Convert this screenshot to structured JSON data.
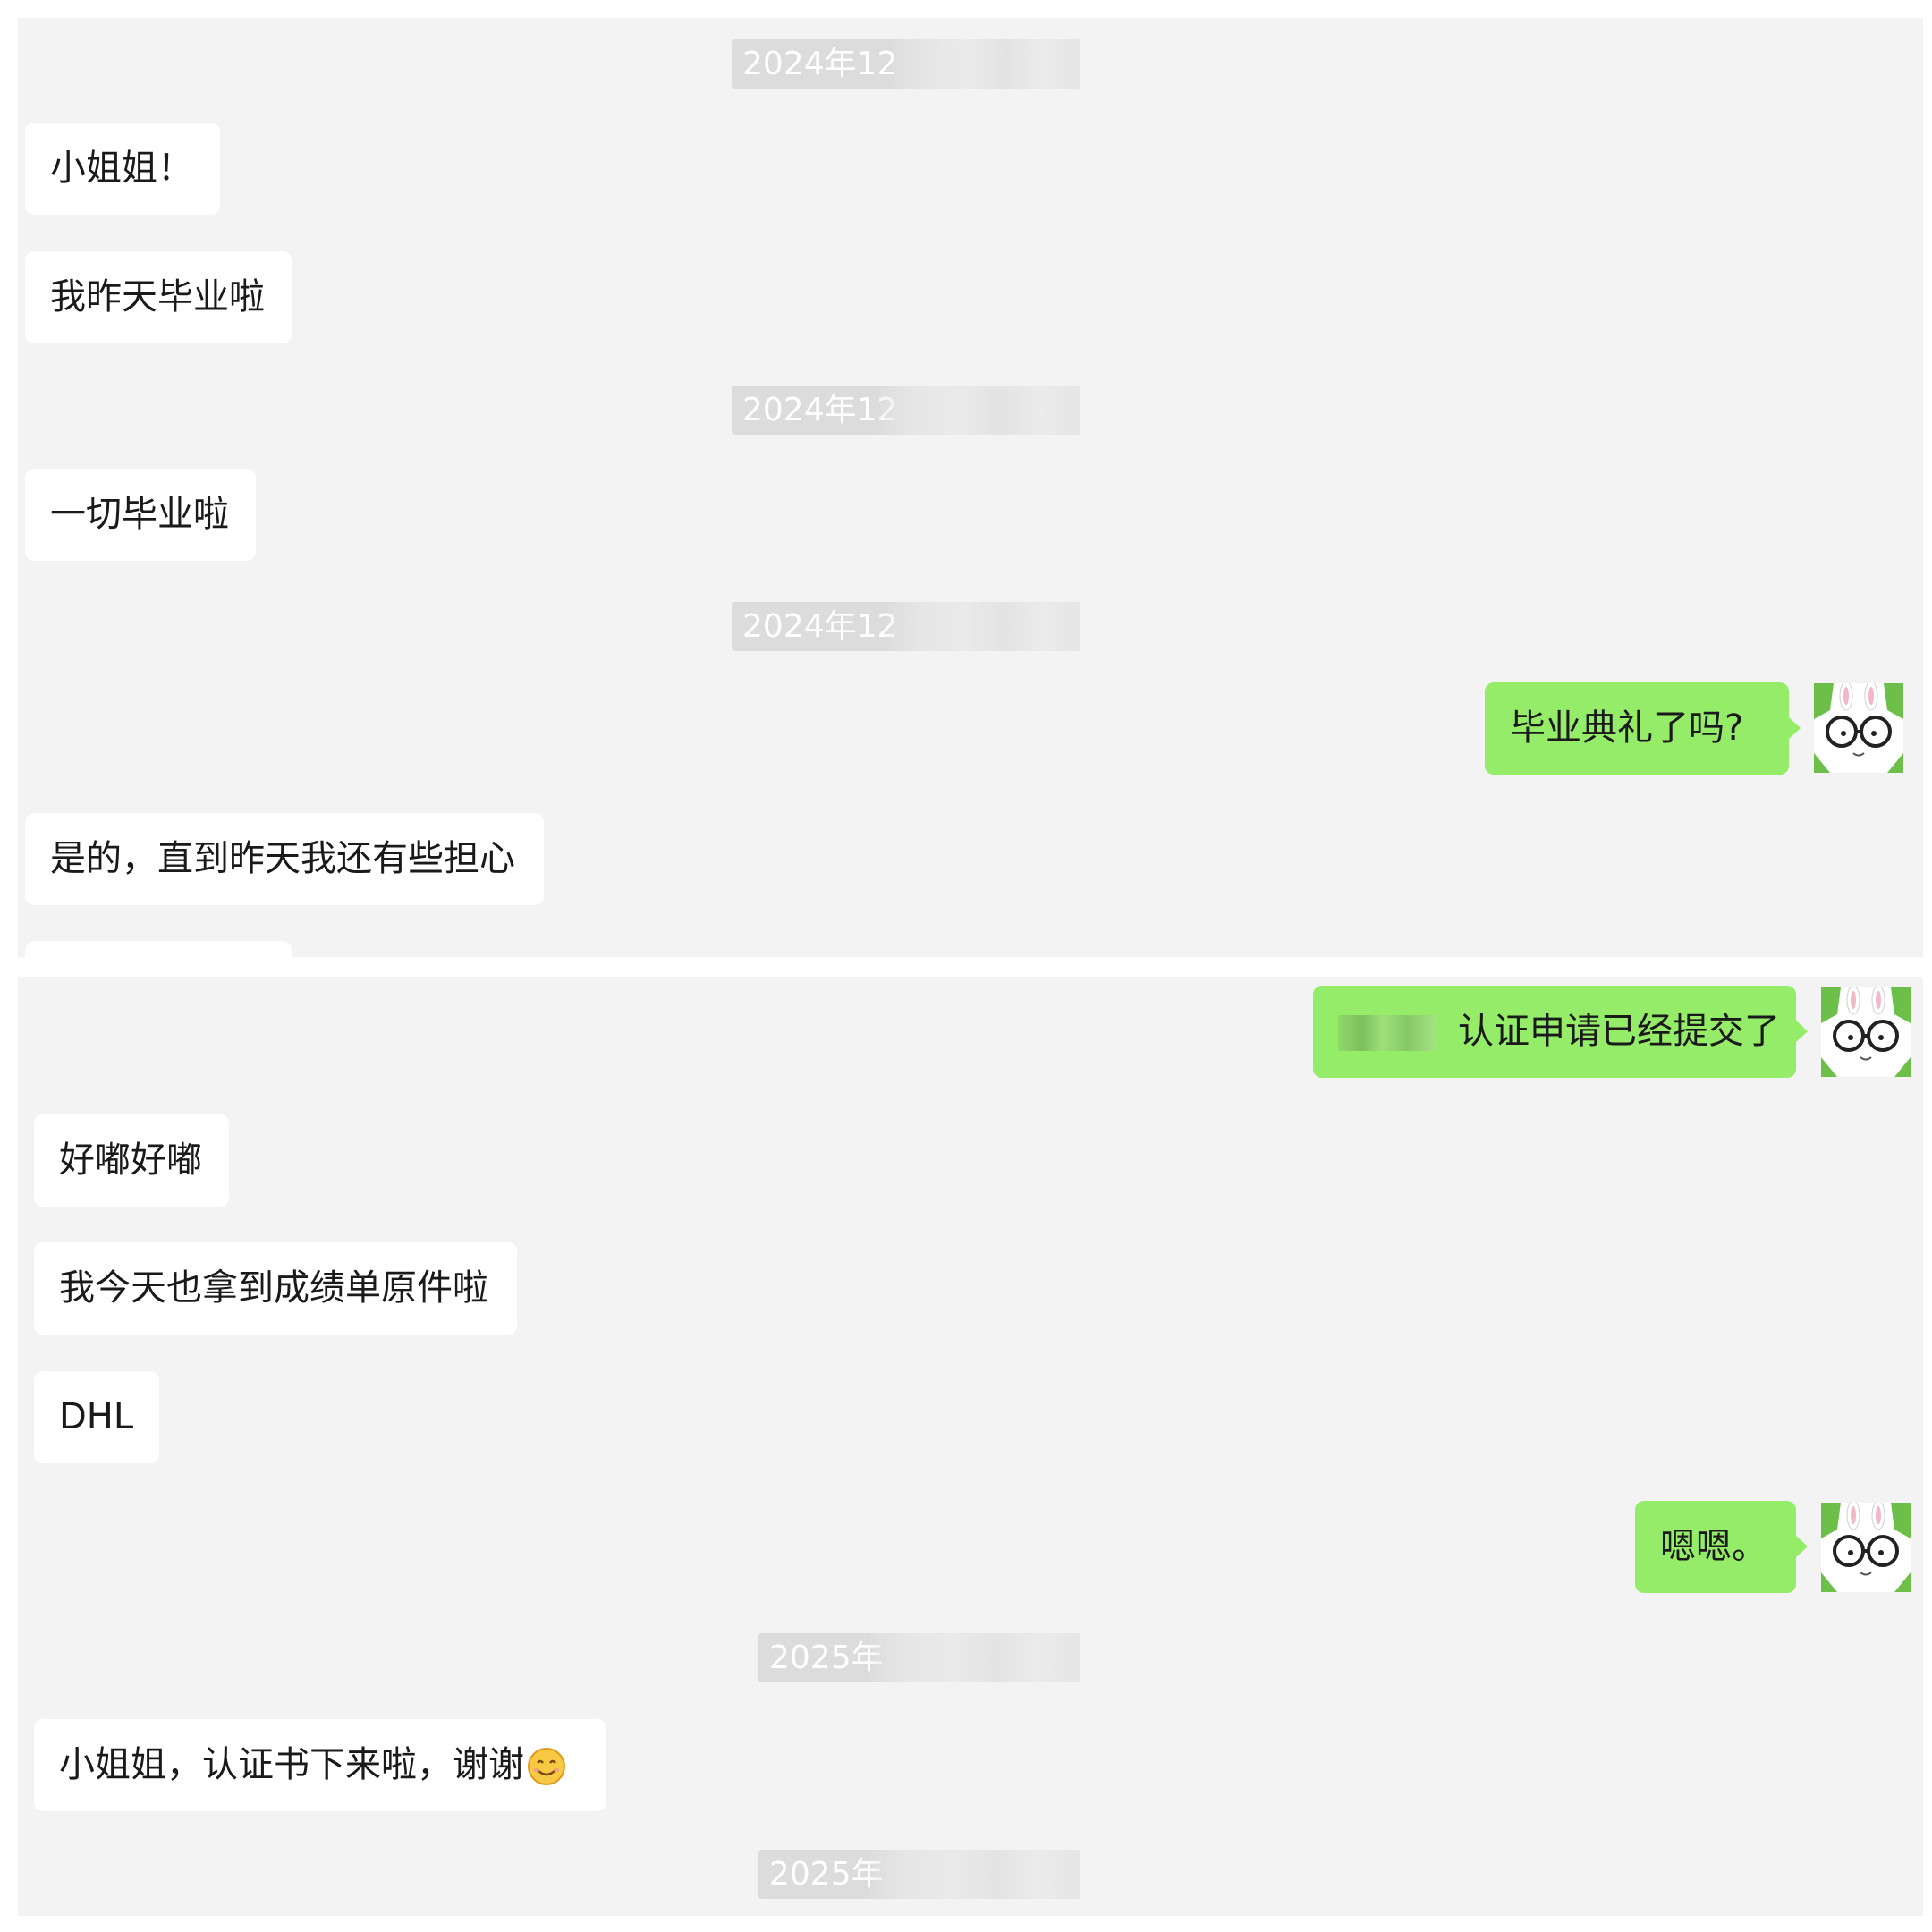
{
  "timestamps": {
    "t1": "2024年12",
    "t2": "2024年12",
    "t3": "2024年12",
    "t4": "2025年",
    "t5": "2025年"
  },
  "messages": {
    "m1": "小姐姐！",
    "m2": "我昨天毕业啦",
    "m3": "一切毕业啦",
    "m4": "毕业典礼了吗?",
    "m5": "是的，直到昨天我还有些担心",
    "m6": "认证申请已经提交了",
    "m7": "好嘟好嘟",
    "m8": "我今天也拿到成绩单原件啦",
    "m9": "DHL",
    "m10": "嗯嗯。",
    "m11": "小姐姐，认证书下来啦，谢谢"
  },
  "icons": {
    "avatar": "cartoon-rabbit-glasses-avatar",
    "emoji": "smiling-face-emoji"
  },
  "colors": {
    "chat_background": "#f3f3f3",
    "incoming_bubble": "#ffffff",
    "outgoing_bubble": "#95ec69",
    "timestamp_bg": "#dcdcdc",
    "avatar_green": "#6cc04a"
  }
}
